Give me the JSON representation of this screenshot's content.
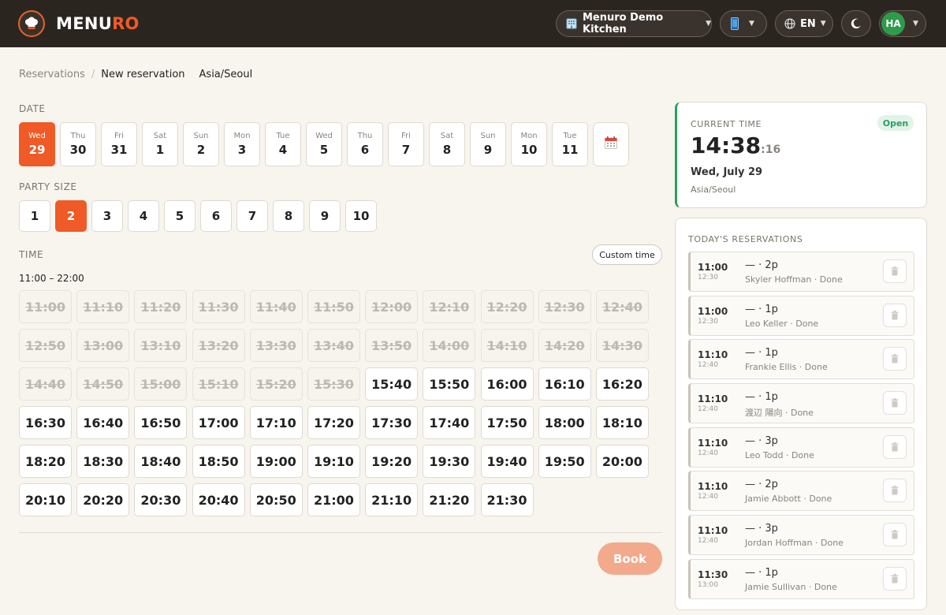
{
  "app": {
    "brand_main": "MENU",
    "brand_accent": "RO",
    "logo_icon": "chef-hat-icon",
    "accent_color": "#ef5a26"
  },
  "topbar": {
    "kitchen": {
      "icon": "building-icon",
      "label": "Menuro Demo Kitchen"
    },
    "device": {
      "icon": "phone-icon"
    },
    "language": {
      "icon": "globe-icon",
      "label": "EN"
    },
    "theme": {
      "icon": "moon-icon"
    },
    "user": {
      "initials": "HA",
      "color": "#2e9b4b"
    }
  },
  "breadcrumb": {
    "parent": "Reservations",
    "current": "New reservation",
    "timezone": "Asia/Seoul"
  },
  "date_section": {
    "label": "DATE",
    "selected_index": 0,
    "dates": [
      {
        "dow": "Wed",
        "day": "29"
      },
      {
        "dow": "Thu",
        "day": "30"
      },
      {
        "dow": "Fri",
        "day": "31"
      },
      {
        "dow": "Sat",
        "day": "1"
      },
      {
        "dow": "Sun",
        "day": "2"
      },
      {
        "dow": "Mon",
        "day": "3"
      },
      {
        "dow": "Tue",
        "day": "4"
      },
      {
        "dow": "Wed",
        "day": "5"
      },
      {
        "dow": "Thu",
        "day": "6"
      },
      {
        "dow": "Fri",
        "day": "7"
      },
      {
        "dow": "Sat",
        "day": "8"
      },
      {
        "dow": "Sun",
        "day": "9"
      },
      {
        "dow": "Mon",
        "day": "10"
      },
      {
        "dow": "Tue",
        "day": "11"
      }
    ],
    "calendar_icon": "calendar-icon"
  },
  "party_section": {
    "label": "PARTY SIZE",
    "selected": "2",
    "options": [
      "1",
      "2",
      "3",
      "4",
      "5",
      "6",
      "7",
      "8",
      "9",
      "10"
    ]
  },
  "time_section": {
    "label": "TIME",
    "custom_button": "Custom time",
    "hours": "11:00 – 22:00",
    "disabled_slots": [
      "11:00",
      "11:10",
      "11:20",
      "11:30",
      "11:40",
      "11:50",
      "12:00",
      "12:10",
      "12:20",
      "12:30",
      "12:40",
      "12:50",
      "13:00",
      "13:10",
      "13:20",
      "13:30",
      "13:40",
      "13:50",
      "14:00",
      "14:10",
      "14:20",
      "14:30",
      "14:40",
      "14:50",
      "15:00",
      "15:10",
      "15:20",
      "15:30"
    ],
    "available_slots": [
      "15:40",
      "15:50",
      "16:00",
      "16:10",
      "16:20",
      "16:30",
      "16:40",
      "16:50",
      "17:00",
      "17:10",
      "17:20",
      "17:30",
      "17:40",
      "17:50",
      "18:00",
      "18:10",
      "18:20",
      "18:30",
      "18:40",
      "18:50",
      "19:00",
      "19:10",
      "19:20",
      "19:30",
      "19:40",
      "19:50",
      "20:00",
      "20:10",
      "20:20",
      "20:30",
      "20:40",
      "20:50",
      "21:00",
      "21:10",
      "21:20",
      "21:30"
    ]
  },
  "book_button": "Book",
  "current_time": {
    "label": "CURRENT TIME",
    "status": "Open",
    "status_color": "#2a9e5f",
    "time": "14:38",
    "seconds": ":16",
    "date": "Wed, July 29",
    "timezone": "Asia/Seoul"
  },
  "todays_reservations": {
    "label": "TODAY'S RESERVATIONS",
    "items": [
      {
        "start": "11:00",
        "end": "12:30",
        "party": "— · 2p",
        "detail": "Skyler Hoffman · Done"
      },
      {
        "start": "11:00",
        "end": "12:30",
        "party": "— · 1p",
        "detail": "Leo Keller · Done"
      },
      {
        "start": "11:10",
        "end": "12:40",
        "party": "— · 1p",
        "detail": "Frankie Ellis · Done"
      },
      {
        "start": "11:10",
        "end": "12:40",
        "party": "— · 1p",
        "detail": "渡辺 陽向 · Done"
      },
      {
        "start": "11:10",
        "end": "12:40",
        "party": "— · 3p",
        "detail": "Leo Todd · Done"
      },
      {
        "start": "11:10",
        "end": "12:40",
        "party": "— · 2p",
        "detail": "Jamie Abbott · Done"
      },
      {
        "start": "11:10",
        "end": "12:40",
        "party": "— · 3p",
        "detail": "Jordan Hoffman · Done"
      },
      {
        "start": "11:30",
        "end": "13:00",
        "party": "— · 1p",
        "detail": "Jamie Sullivan · Done"
      }
    ],
    "delete_icon": "trash-icon"
  }
}
